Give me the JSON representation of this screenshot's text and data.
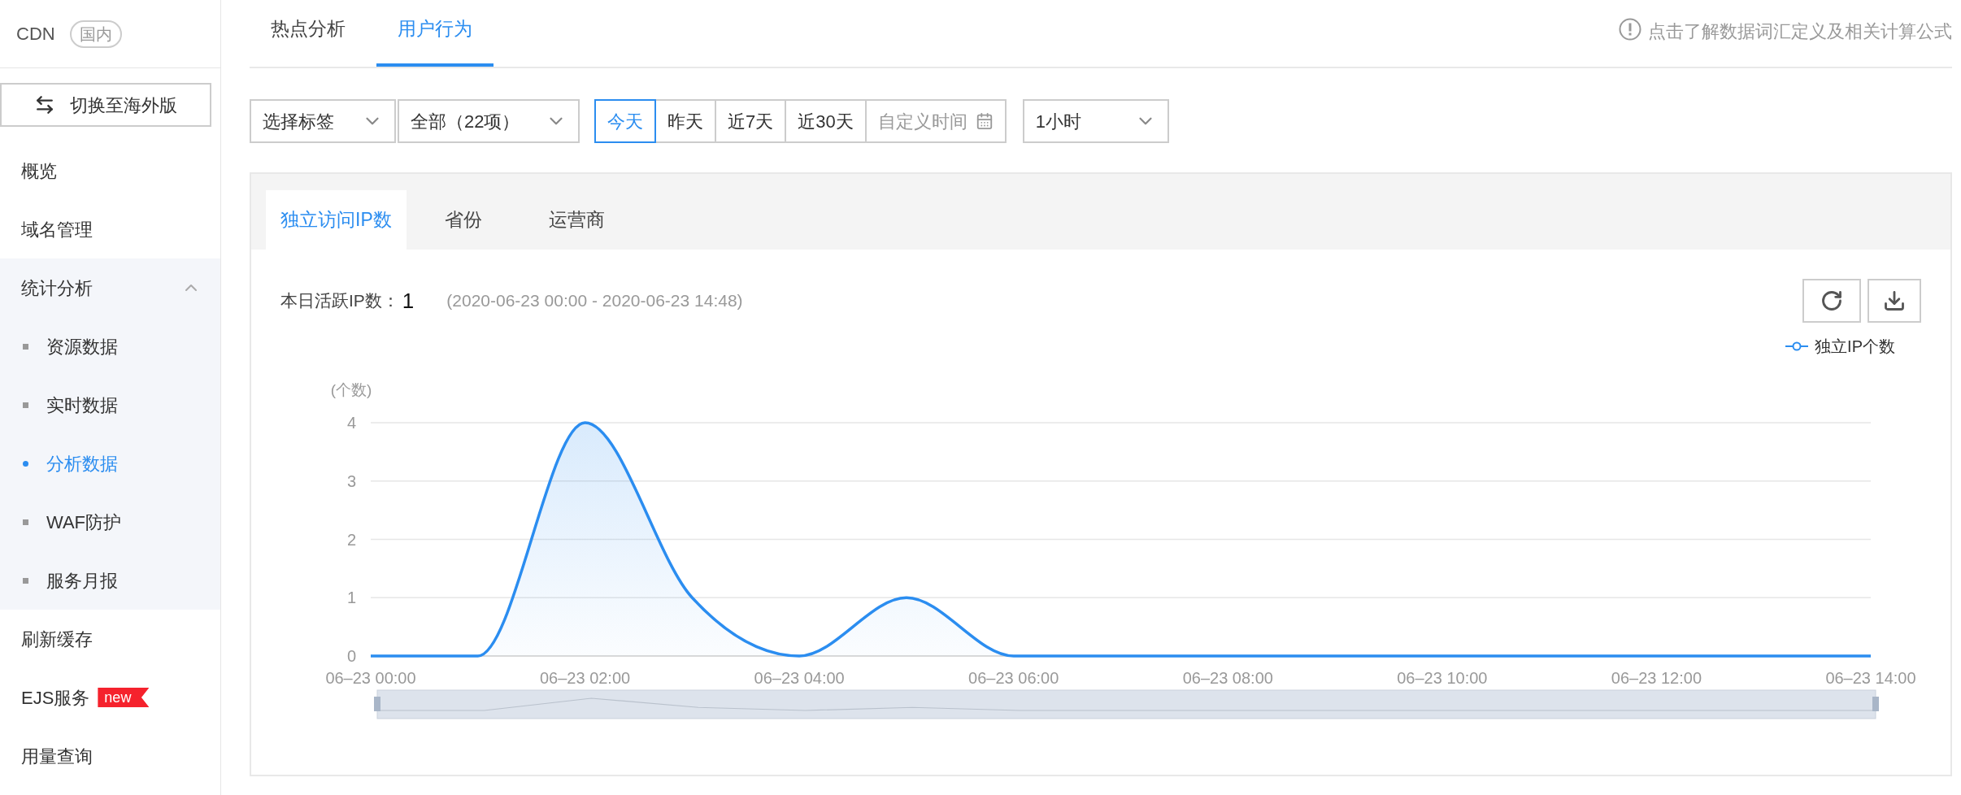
{
  "sidebar": {
    "product": "CDN",
    "region_badge": "国内",
    "switch_button": "切换至海外版",
    "items": [
      {
        "kind": "link",
        "label": "概览",
        "selected": false
      },
      {
        "kind": "link",
        "label": "域名管理",
        "selected": false
      },
      {
        "kind": "group",
        "label": "统计分析",
        "selected": false,
        "expanded": true,
        "children": [
          {
            "label": "资源数据",
            "selected": false
          },
          {
            "label": "实时数据",
            "selected": false
          },
          {
            "label": "分析数据",
            "selected": true
          },
          {
            "label": "WAF防护",
            "selected": false
          },
          {
            "label": "服务月报",
            "selected": false
          }
        ]
      },
      {
        "kind": "link",
        "label": "刷新缓存",
        "selected": false
      },
      {
        "kind": "link",
        "label": "EJS服务",
        "selected": false,
        "badge": "new"
      },
      {
        "kind": "link",
        "label": "用量查询",
        "selected": false
      }
    ]
  },
  "top_tabs": [
    {
      "label": "热点分析",
      "selected": false
    },
    {
      "label": "用户行为",
      "selected": true
    }
  ],
  "help_link": "点击了解数据词汇定义及相关计算公式",
  "filters": {
    "tag_select": "选择标签",
    "scope_select": "全部（22项）",
    "date_range": [
      {
        "kind": "preset",
        "label": "今天",
        "selected": true
      },
      {
        "kind": "preset",
        "label": "昨天",
        "selected": false
      },
      {
        "kind": "preset",
        "label": "近7天",
        "selected": false
      },
      {
        "kind": "preset",
        "label": "近30天",
        "selected": false
      },
      {
        "kind": "custom",
        "label": "自定义时间",
        "selected": false
      }
    ],
    "granularity_select": "1小时"
  },
  "panel": {
    "tabs": [
      {
        "label": "独立访问IP数",
        "selected": true
      },
      {
        "label": "省份",
        "selected": false
      },
      {
        "label": "运营商",
        "selected": false
      }
    ],
    "summary": {
      "label": "本日活跃IP数：",
      "value": "1",
      "range": "(2020-06-23 00:00 - 2020-06-23 14:48)"
    },
    "chart_data": {
      "type": "area",
      "ylabel": "(个数)",
      "categories": [
        "06–23 00:00",
        null,
        "06–23 02:00",
        null,
        "06–23 04:00",
        null,
        "06–23 06:00",
        null,
        "06–23 08:00",
        null,
        "06–23 10:00",
        null,
        "06–23 12:00",
        null,
        "06–23 14:00"
      ],
      "ylim": [
        0,
        4
      ],
      "yticks": [
        0,
        1,
        2,
        3,
        4
      ],
      "grid": true,
      "series": [
        {
          "name": "独立IP个数",
          "color": "#2b8df0",
          "values": [
            0,
            0,
            4,
            1,
            0,
            1,
            0,
            0,
            0,
            0,
            0,
            0,
            0,
            0,
            0
          ]
        }
      ]
    }
  }
}
